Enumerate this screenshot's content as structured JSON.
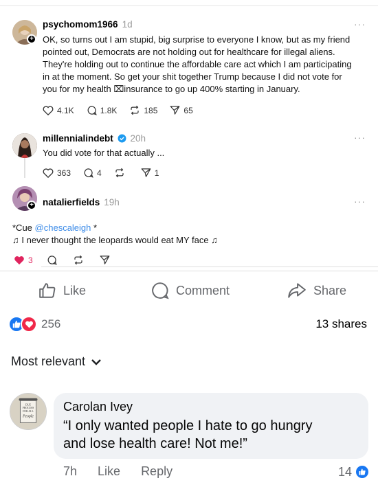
{
  "thread": {
    "post1": {
      "username": "psychomom1966",
      "time": "1d",
      "lines": [
        "OK, so turns out I am stupid, big surprise to everyone I know, but as my friend",
        "pointed out, Democrats are not holding out for healthcare for illegal aliens.",
        "They're holding out to continue the affordable care act which I am participating",
        "in at the moment. So get your shit together Trump because I did not vote for",
        "you for my health ⌧insurance to go up 400% starting in January."
      ],
      "likes": "4.1K",
      "replies": "1.8K",
      "reposts": "185",
      "shares": "65"
    },
    "post2": {
      "username": "millennialindebt",
      "time": "20h",
      "text": "You did vote for that actually ...",
      "likes": "363",
      "replies": "4",
      "shares": "1"
    },
    "post3": {
      "username": "natalierfields",
      "time": "19h",
      "line1_prefix": "*Cue ",
      "line1_mention": "@chescaleigh",
      "line1_suffix": " *",
      "line2": "♫ I never thought the leopards would eat MY face ♫",
      "likes": "3"
    }
  },
  "facebook": {
    "like_label": "Like",
    "comment_label": "Comment",
    "share_label": "Share",
    "reaction_count": "256",
    "shares_text": "13 shares",
    "sort_label": "Most relevant",
    "comment": {
      "author": "Carolan Ivey",
      "text_line1": "“I only wanted people I hate to go hungry",
      "text_line2": "and lose health care! Not me!”",
      "time": "7h",
      "like": "Like",
      "reply": "Reply",
      "like_count": "14"
    },
    "avatar_text": [
      "DUE",
      "PROCESS",
      "FOR ALL",
      "People"
    ]
  },
  "colors": {
    "facebook_blue": "#1877f2",
    "love_red": "#f02849",
    "mention_blue": "#3a8ae8",
    "threads_like_red": "#e0245e"
  }
}
